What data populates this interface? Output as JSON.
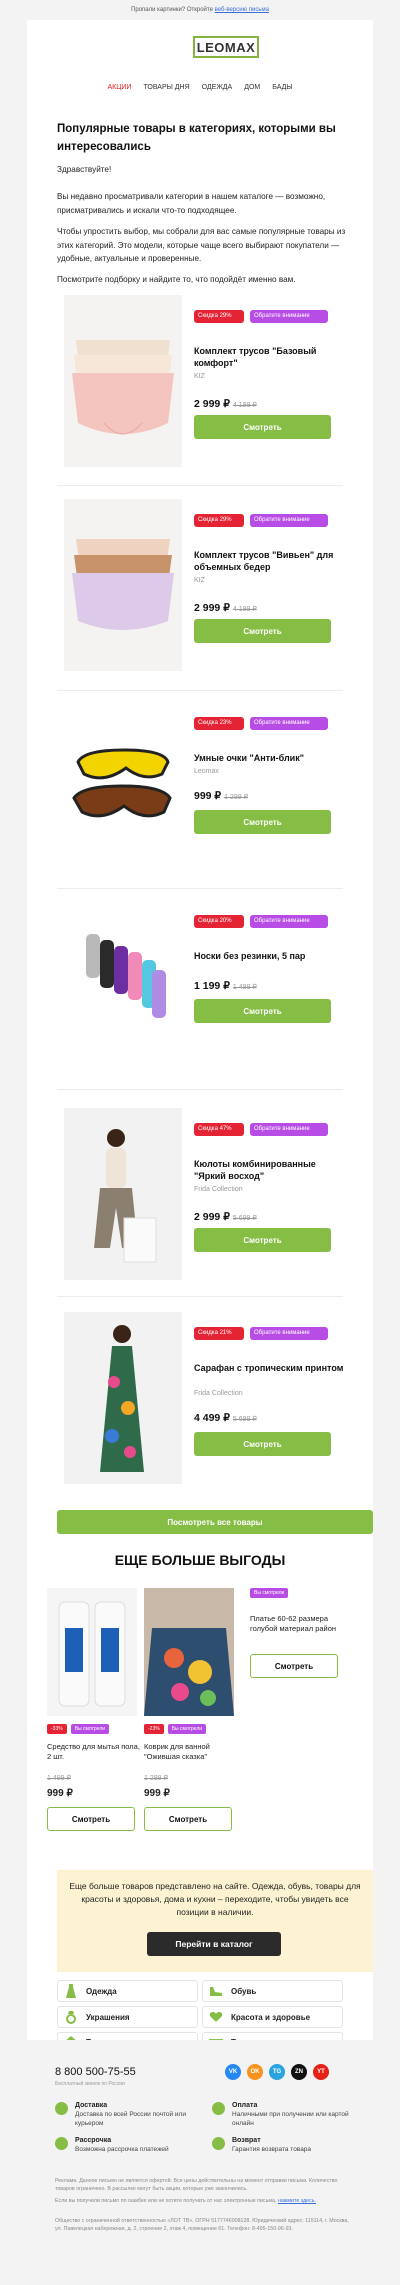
{
  "preheader": {
    "text": "Пропали картинки? Откройте",
    "link": "веб-версию письма"
  },
  "logo": "LEOMAX",
  "nav": [
    "АКЦИИ",
    "ТОВАРЫ ДНЯ",
    "ОДЕЖДА",
    "ДОМ",
    "БАДЫ"
  ],
  "title": "Популярные товары в категориях, которыми вы интересовались",
  "greeting": "Здравствуйте!",
  "para1": "Вы недавно просматривали категории в нашем каталоге — возможно, присматривались и искали что-то подходящее.",
  "para2": "Чтобы упростить выбор, мы собрали для вас самые популярные товары из этих категорий. Это модели, которые чаще всего выбирают покупатели — удобные, актуальные и проверенные.",
  "para3": "Посмотрите подборку и найдите то, что подойдёт именно вам.",
  "attention_badge": "Обратите внимание",
  "products": [
    {
      "discount": "Скидка 29%",
      "name": "Комплект трусов \"Базовый комфорт\"",
      "brand": "KIZ",
      "price": "2 999 ₽",
      "old": "4 199 ₽",
      "button": "Смотреть"
    },
    {
      "discount": "Скидка 29%",
      "name": "Комплект трусов \"Вивьен\" для объемных бедер",
      "brand": "KIZ",
      "price": "2 999 ₽",
      "old": "4 199 ₽",
      "button": "Смотреть"
    },
    {
      "discount": "Скидка 23%",
      "name": "Умные очки \"Анти-блик\"",
      "brand": "Leomax",
      "price": "999 ₽",
      "old": "1 299 ₽",
      "button": "Смотреть"
    },
    {
      "discount": "Скидка 20%",
      "name": "Носки без резинки, 5 пар",
      "brand": "",
      "price": "1 199 ₽",
      "old": "1 499 ₽",
      "button": "Смотреть"
    },
    {
      "discount": "Скидка 47%",
      "name": "Кюлоты комбинированные \"Яркий восход\"",
      "brand": "Frida Collection",
      "price": "2 999 ₽",
      "old": "5 699 ₽",
      "button": "Смотреть"
    },
    {
      "discount": "Скидка 21%",
      "name": "Сарафан с тропическим принтом",
      "brand": "Frida Collection",
      "price": "4 499 ₽",
      "old": "5 699 ₽",
      "button": "Смотреть"
    }
  ],
  "all_button": "Посмотреть все товары",
  "more_title": "ЕЩЕ БОЛЬШЕ ВЫГОДЫ",
  "small_products": [
    {
      "discount": "-33%",
      "viewed": "Вы смотрели",
      "name": "Средство для мытья пола, 2 шт.",
      "old": "1 499 ₽",
      "price": "999 ₽",
      "button": "Смотреть"
    },
    {
      "discount": "-23%",
      "viewed": "Вы смотрели",
      "name": "Коврик для ванной \"Ожившая сказка\"",
      "old": "1 299 ₽",
      "price": "999 ₽",
      "button": "Смотреть"
    },
    {
      "viewed": "Вы смотрели",
      "name": "Платье 60-62 размера голубой материал район",
      "button": "Смотреть"
    }
  ],
  "promo": {
    "text": "Еще больше товаров представлено на сайте. Одежда, обувь, товары для красоты и здоровья, дома и кухни – переходите, чтобы увидеть все позиции в наличии.",
    "button": "Перейти в каталог"
  },
  "categories": [
    "Одежда",
    "Обувь",
    "Украшения",
    "Красота и здоровье",
    "Товары для дома",
    "Товары для кухни"
  ],
  "footer": {
    "phone": "8 800 500-75-55",
    "phone_sub": "Бесплатный звонок по России",
    "social": [
      "VK",
      "OK",
      "TG",
      "ZN",
      "YT"
    ],
    "info": [
      {
        "title": "Доставка",
        "desc": "Доставка по всей России почтой или курьером"
      },
      {
        "title": "Оплата",
        "desc": "Наличными при получении или картой онлайн"
      },
      {
        "title": "Рассрочка",
        "desc": "Возможна рассрочка платежей"
      },
      {
        "title": "Возврат",
        "desc": "Гарантия возврата товара"
      }
    ],
    "disclaimer": "Реклама. Данное письмо не является офертой. Все цены действительны на момент отправки письма. Количество товаров ограничено. В рассылке могут быть акции, которые уже закончились.",
    "unsub_text": "Если вы получили письмо по ошибке или не хотите получать от нас электронные письма,",
    "unsub_link": "нажмите здесь.",
    "legal": "Общество с ограниченной ответственностью «ЛОТ ТВ», ОГРН 5177746008128. Юридический адрес: 115114, г. Москва, ул. Павелецкая набережная, д. 2, строение 2, этаж 4, помещение 61. Телефон: 8-495-150-96-93."
  }
}
